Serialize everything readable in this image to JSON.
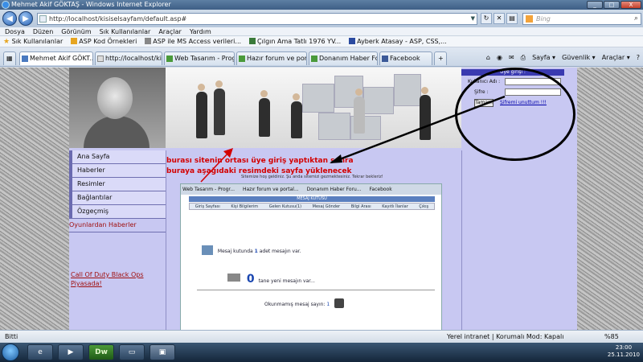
{
  "window": {
    "title": "Mehmet Akif GÖKTAŞ - Windows Internet Explorer",
    "min": "_",
    "max": "□",
    "close": "X"
  },
  "address_bar": {
    "url": "http://localhost/kisiselsayfam/default.asp#",
    "search_placeholder": "Bing",
    "back": "◀",
    "forward": "▶"
  },
  "menu": {
    "items": [
      "Dosya",
      "Düzen",
      "Görünüm",
      "Sık Kullanılanlar",
      "Araçlar",
      "Yardım"
    ]
  },
  "favorites": {
    "label": "Sık Kullanılanlar",
    "items": [
      "ASP Kod Örnekleri",
      "ASP ile MS Access verileri...",
      "Çılgın Ama Tatlı 1976 YV...",
      "Ayberk Atasay - ASP, CSS,..."
    ]
  },
  "tabs": {
    "items": [
      "Mehmet Akif GÖKT...",
      "http://localhost/kisis...",
      "Web Tasarım - Progr...",
      "Hazır forum ve portal...",
      "Donanım Haber Foru...",
      "Facebook"
    ],
    "tools": [
      "Sayfa ▾",
      "Güvenlik ▾",
      "Araçlar ▾"
    ]
  },
  "site": {
    "login": {
      "header": "Üye girişi :",
      "username_label": "Kullanıcı Adı :",
      "password_label": "Şifre :",
      "submit": "Tamam",
      "forgot": "Şifremi unuttum !!!"
    },
    "nav": [
      "Ana Sayfa",
      "Haberler",
      "Resimler",
      "Bağlantılar",
      "Özgeçmiş"
    ],
    "games_title": "Oyunlardan Haberler",
    "game_link": "Call Of Duty Black Ops Piyasada!",
    "annotation_line1": "burası sitenin ortası üye giriş yaptıktan sonra",
    "annotation_line2": "buraya aşağıdaki resimdeki sayfa yüklenecek",
    "tiny_welcome": "Sitemize hoş geldiniz. Şu anda sitemizi gezmektesiniz. Tekrar bekleriz!",
    "inner": {
      "tabs": [
        "Web Tasarım - Progr...",
        "Hazır forum ve portal...",
        "Donanım Haber Foru...",
        "Facebook"
      ],
      "header": "MESAJ KUTUSU",
      "nav": [
        "Giriş Sayfası",
        "Kişi Bilgilerim",
        "Gelen Kutusu(1)",
        "Mesaj Gönder",
        "Bilgi Arası",
        "Kayıtlı İlanlar",
        "Çıkış"
      ],
      "msg1_prefix": "Mesaj kutunda",
      "msg1_count": "1",
      "msg1_suffix": "adet mesajın var.",
      "msg2_count": "0",
      "msg2_text": "tane yeni mesajın var...",
      "msg3_text": "Okunmamış mesaj sayın:",
      "msg3_count": "1"
    }
  },
  "statusbar": {
    "left": "Bitti",
    "zone": "Yerel intranet | Korumalı Mod: Kapalı",
    "zoom": "%85"
  },
  "taskbar": {
    "dw_label": "Dw",
    "time": "23:00",
    "date": "25.11.2010"
  }
}
